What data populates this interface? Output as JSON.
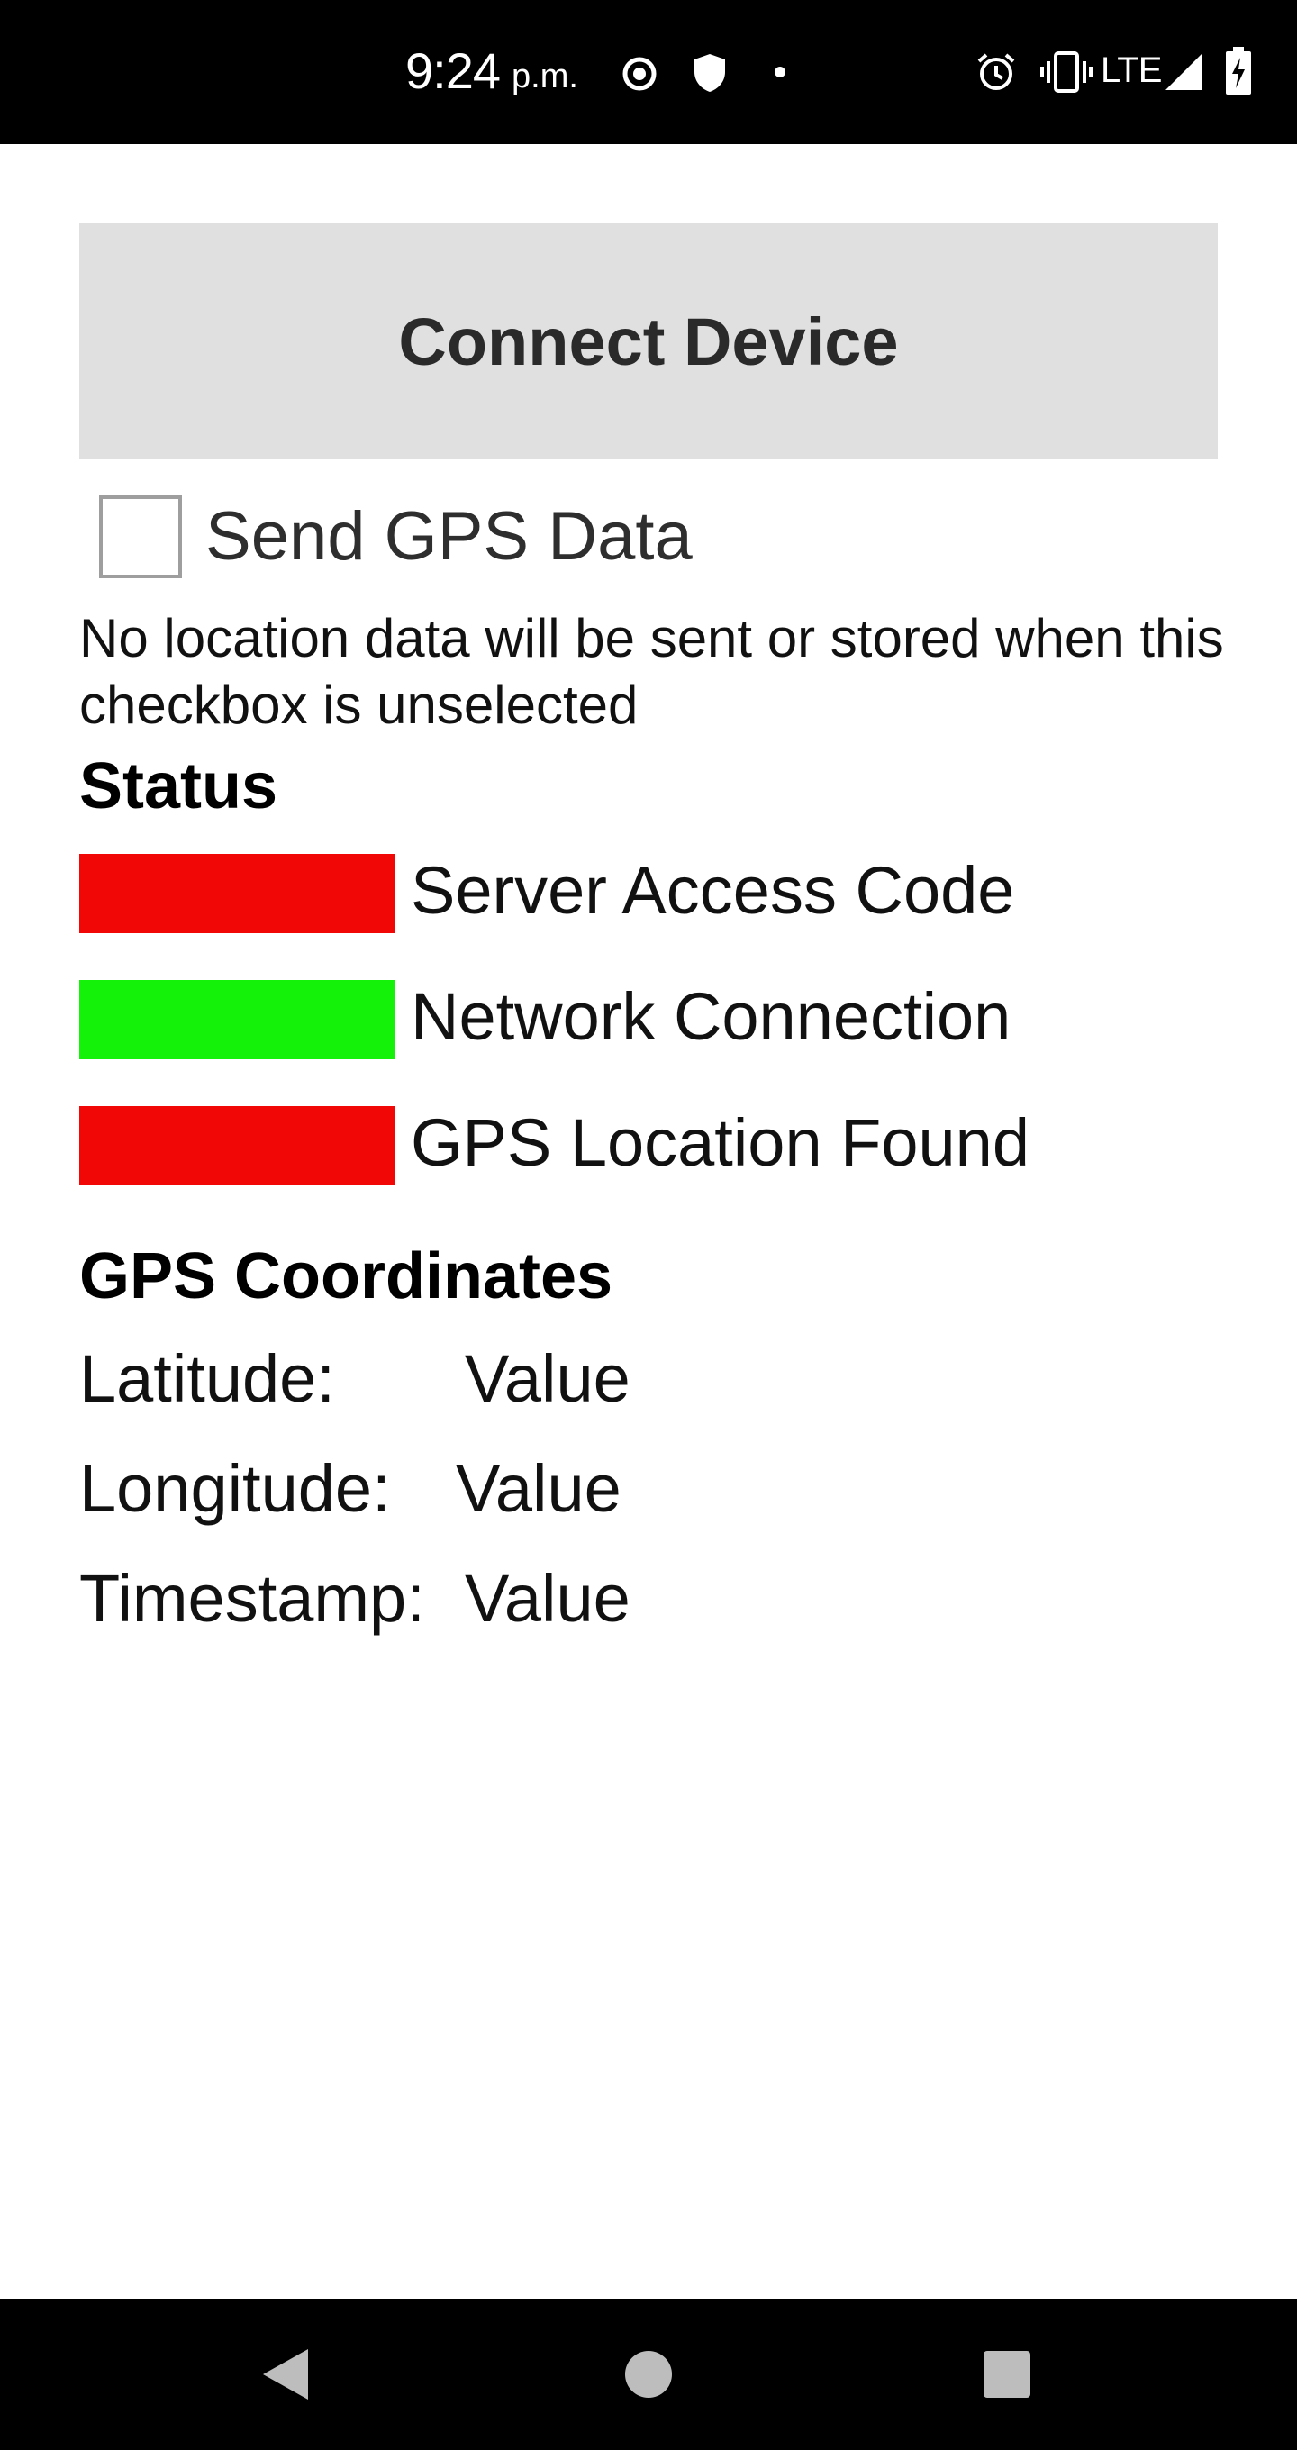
{
  "status_bar": {
    "time": "9:24",
    "ampm": "p.m.",
    "network": "LTE",
    "icons": [
      "record-icon",
      "shield-icon",
      "dot-icon",
      "alarm-icon",
      "vibrate-icon",
      "signal-icon",
      "battery-charging-icon"
    ]
  },
  "connect_button": {
    "label": "Connect Device"
  },
  "gps_toggle": {
    "label": "Send GPS Data",
    "checked": false
  },
  "hint": "No location data will be sent or stored when this checkbox is unselected",
  "status": {
    "title": "Status",
    "items": [
      {
        "label": "Server Access Code",
        "color": "#f20707"
      },
      {
        "label": "Network Connection",
        "color": "#15f20a"
      },
      {
        "label": "GPS Location Found",
        "color": "#f20707"
      }
    ]
  },
  "gps": {
    "title": "GPS Coordinates",
    "rows": [
      {
        "label": "Latitude:",
        "value": "Value"
      },
      {
        "label": "Longitude:",
        "value": "Value"
      },
      {
        "label": "Timestamp:",
        "value": "Value"
      }
    ]
  },
  "nav": {
    "icons": [
      "back-icon",
      "home-icon",
      "recents-icon"
    ]
  }
}
